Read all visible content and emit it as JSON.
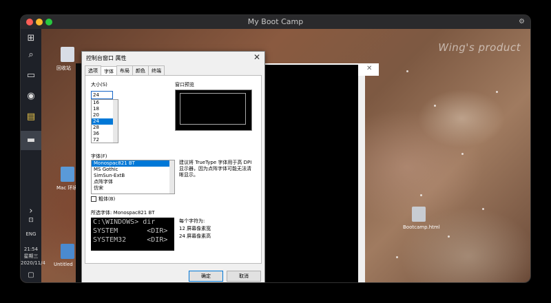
{
  "window": {
    "title": "My Boot Camp"
  },
  "watermark": "Wing's product",
  "taskbar": {
    "clock_time": "21:54",
    "clock_day": "星期三",
    "clock_date": "2020/11/4",
    "lang": "ENG"
  },
  "desktop": {
    "icons": [
      {
        "label": "回收站"
      },
      {
        "label": "Mac 环境"
      },
      {
        "label": "Untitled"
      },
      {
        "label": "Bootcamp.html"
      }
    ]
  },
  "dialog": {
    "title": "控制台窗口 属性",
    "tabs": [
      "选项",
      "字体",
      "布局",
      "颜色",
      "终端"
    ],
    "active_tab": "字体",
    "size_group_label": "大小(S)",
    "size_value": "24",
    "sizes": [
      "16",
      "18",
      "20",
      "24",
      "28",
      "36",
      "72"
    ],
    "selected_size": "24",
    "preview_label": "窗口预览",
    "font_group_label": "字体(F)",
    "fonts": [
      "Monospac821 BT",
      "MS Gothic",
      "SimSun-ExtB",
      "点阵字体",
      "仿宋"
    ],
    "selected_font": "Monospac821 BT",
    "font_note": "建议将 TrueType 字体用于高 DPI 显示器，因为点阵字体可能无法清晰显示。",
    "bold_label": "粗体(B)",
    "selected_font_label": "所选字体: Monospac821 BT",
    "sample_lines": [
      "C:\\WINDOWS> dir",
      "SYSTEM       <DIR>",
      "SYSTEM32     <DIR>"
    ],
    "char_size_label": "每个字符为:",
    "char_width": "12 屏幕像素宽",
    "char_height": "24 屏幕像素高",
    "ok_label": "确定",
    "cancel_label": "取消"
  }
}
